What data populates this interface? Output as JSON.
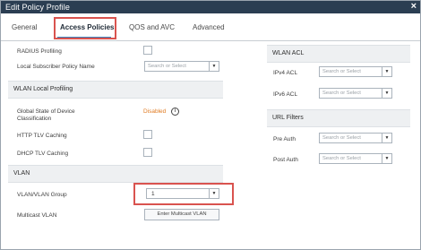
{
  "window": {
    "title": "Edit Policy Profile",
    "close_icon": "×"
  },
  "tabs": [
    {
      "label": "General"
    },
    {
      "label": "Access Policies"
    },
    {
      "label": "QOS and AVC"
    },
    {
      "label": "Advanced"
    }
  ],
  "left": {
    "radius_profiling": {
      "label": "RADIUS Profiling"
    },
    "local_subscriber": {
      "label": "Local Subscriber Policy Name",
      "placeholder": "Search or Select"
    },
    "wlan_local_profiling": {
      "title": "WLAN Local Profiling"
    },
    "global_state": {
      "label": "Global State of Device Classification",
      "value": "Disabled",
      "info_icon": "i"
    },
    "http_tlv": {
      "label": "HTTP TLV Caching"
    },
    "dhcp_tlv": {
      "label": "DHCP TLV Caching"
    },
    "vlan_section": {
      "title": "VLAN"
    },
    "vlan_group": {
      "label": "VLAN/VLAN Group",
      "value": "1"
    },
    "multicast_vlan": {
      "label": "Multicast VLAN",
      "button": "Enter Multicast VLAN"
    }
  },
  "right": {
    "wlan_acl": {
      "title": "WLAN ACL"
    },
    "ipv4_acl": {
      "label": "IPv4 ACL",
      "placeholder": "Search or Select"
    },
    "ipv6_acl": {
      "label": "IPv6 ACL",
      "placeholder": "Search or Select"
    },
    "url_filters": {
      "title": "URL Filters"
    },
    "pre_auth": {
      "label": "Pre Auth",
      "placeholder": "Search or Select"
    },
    "post_auth": {
      "label": "Post Auth",
      "placeholder": "Search or Select"
    }
  },
  "arrow_glyph": "▼",
  "colors": {
    "titlebar": "#2b3e52",
    "highlight": "#d9534f",
    "status": "#e07b22",
    "tab_accent": "#3b83bd"
  }
}
